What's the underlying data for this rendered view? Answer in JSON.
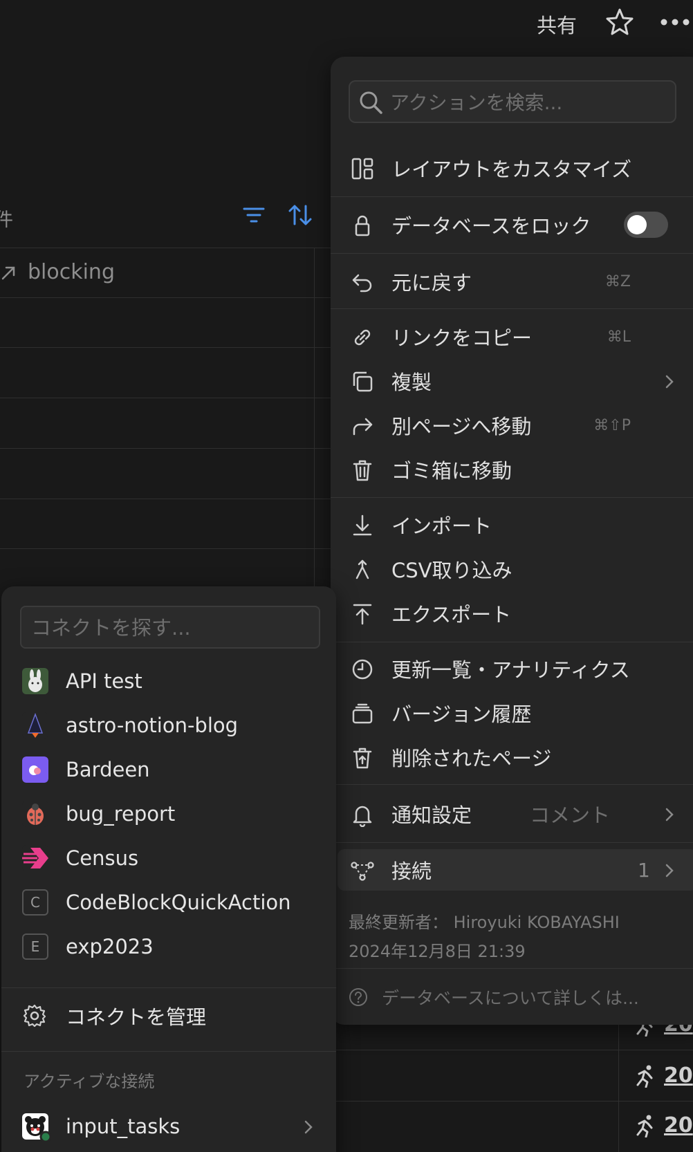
{
  "topbar": {
    "share_label": "共有"
  },
  "background_table": {
    "count_suffix": "件",
    "column_header": "blocking",
    "runner_values": [
      "20",
      "20",
      "20"
    ]
  },
  "action_menu": {
    "search_placeholder": "アクションを検索...",
    "items": {
      "customize_layout": "レイアウトをカスタマイズ",
      "lock_database": "データベースをロック",
      "undo": "元に戻す",
      "undo_shortcut": "⌘Z",
      "copy_link": "リンクをコピー",
      "copy_link_shortcut": "⌘L",
      "duplicate": "複製",
      "move_to": "別ページへ移動",
      "move_to_shortcut": "⌘⇧P",
      "trash": "ゴミ箱に移動",
      "import": "インポート",
      "csv_import": "CSV取り込み",
      "export": "エクスポート",
      "updates_analytics": "更新一覧・アナリティクス",
      "version_history": "バージョン履歴",
      "deleted_pages": "削除されたページ",
      "notifications": "通知設定",
      "notifications_value": "コメント",
      "connections": "接続",
      "connections_count": "1"
    },
    "lock_toggle_on": false,
    "last_edited_by": "最終更新者： Hiroyuki KOBAYASHI",
    "last_edited_at": "2024年12月8日 21:39",
    "learn_more": "データベースについて詳しくは..."
  },
  "connections_menu": {
    "search_placeholder": "コネクトを探す...",
    "integrations": [
      {
        "name": "API test",
        "icon": "rabbit-avatar"
      },
      {
        "name": "astro-notion-blog",
        "icon": "rocket-avatar"
      },
      {
        "name": "Bardeen",
        "icon": "bardeen-logo"
      },
      {
        "name": "bug_report",
        "icon": "ladybug-avatar"
      },
      {
        "name": "Census",
        "icon": "census-logo"
      },
      {
        "name": "CodeBlockQuickAction",
        "icon": "letter-avatar",
        "letter": "C"
      },
      {
        "name": "exp2023",
        "icon": "letter-avatar",
        "letter": "E"
      }
    ],
    "manage_label": "コネクトを管理",
    "active_section": "アクティブな接続",
    "active": {
      "name": "input_tasks",
      "icon": "bear-avatar"
    }
  },
  "colors": {
    "background": "#191919",
    "menu_bg": "#252525",
    "accent_blue": "#4a8fe7",
    "census_pink": "#e83e8c",
    "bardeen_purple": "#7b5cf0"
  }
}
